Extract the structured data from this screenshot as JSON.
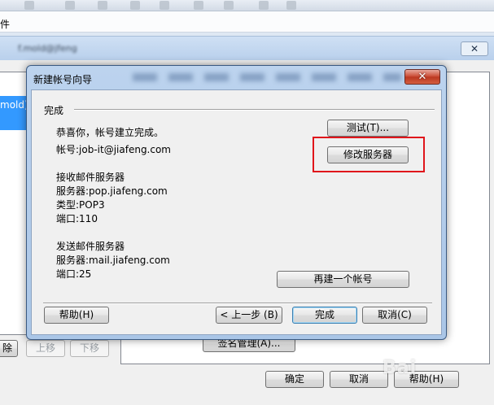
{
  "app": {
    "menu_fragment": "件",
    "bg_title_fragment": "f.mold@jfeng",
    "bg_close_icon": "✕",
    "bg_list_selected": "mold)"
  },
  "bg_buttons": {
    "remove": "除",
    "move_up": "上移",
    "move_down": "下移",
    "signature": "签名管理(A)...",
    "ok": "确定",
    "cancel": "取消",
    "help": "帮助(H)"
  },
  "watermark": "Bai",
  "wizard": {
    "title": "新建帐号向导",
    "close_icon": "✕",
    "section": "完成",
    "congrats": "恭喜你，帐号建立完成。",
    "account": "帐号:job-it@jiafeng.com",
    "incoming_heading": "接收邮件服务器",
    "incoming_server": "服务器:pop.jiafeng.com",
    "incoming_type": "类型:POP3",
    "incoming_port": "端口:110",
    "outgoing_heading": "发送邮件服务器",
    "outgoing_server": "服务器:mail.jiafeng.com",
    "outgoing_port": "端口:25",
    "buttons": {
      "test": "测试(T)...",
      "modify_server": "修改服务器",
      "new_account": "再建一个帐号",
      "help": "帮助(H)",
      "back": "< 上一步 (B)",
      "finish": "完成",
      "cancel": "取消(C)"
    }
  },
  "colors": {
    "highlight_box": "#e0151b",
    "selection": "#3399ff"
  }
}
